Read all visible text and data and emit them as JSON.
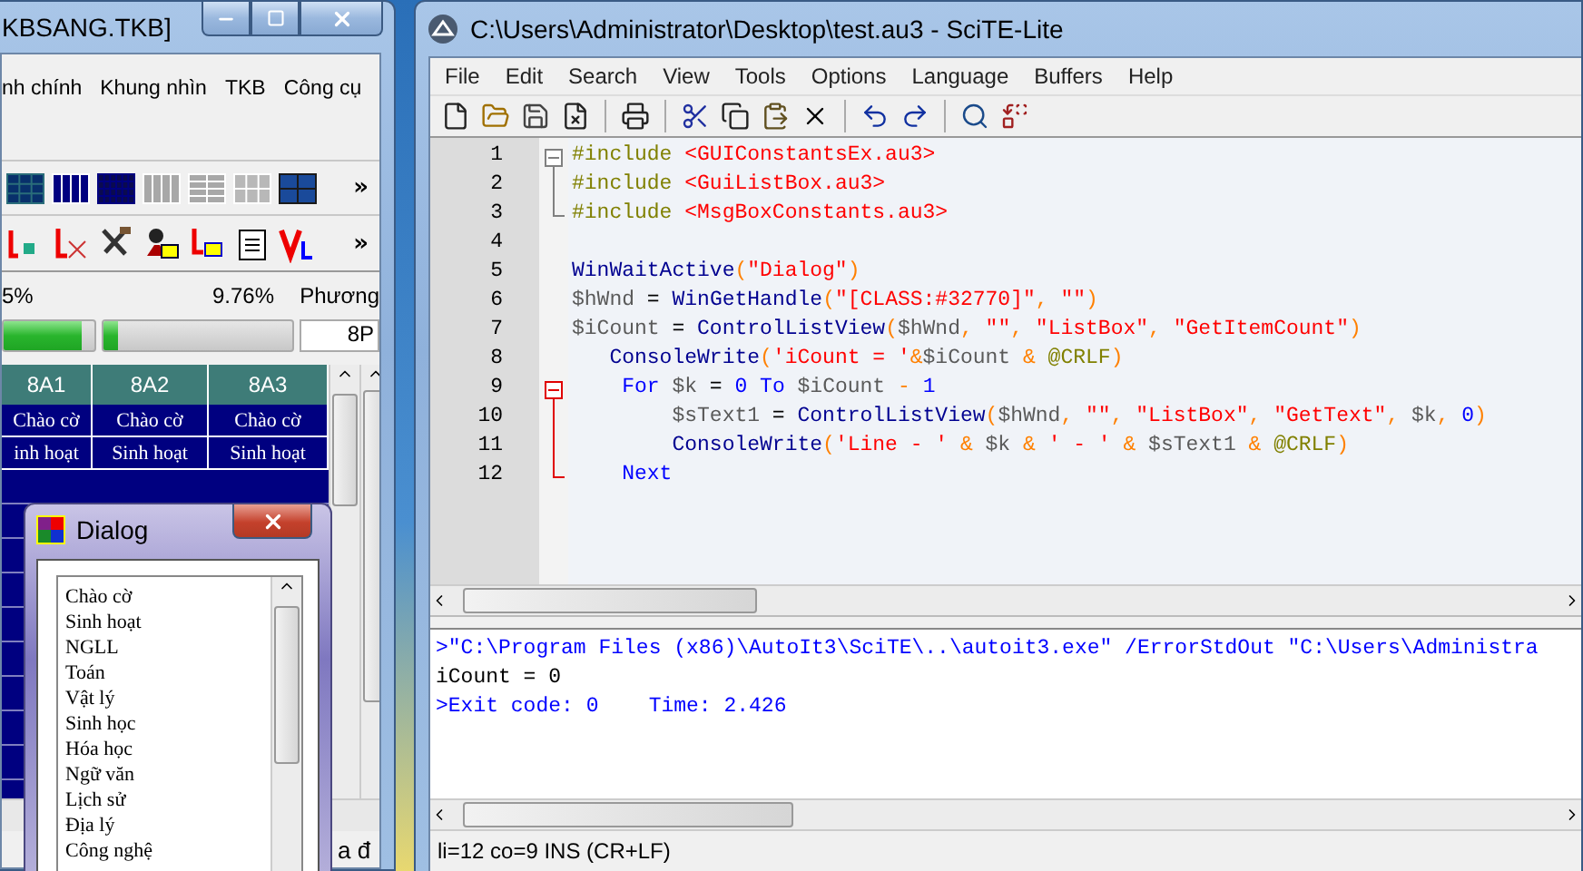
{
  "left_window": {
    "title": "KBSANG.TKB]",
    "menu": [
      "nh chính",
      "Khung nhìn",
      "TKB",
      "Công cụ"
    ],
    "toolbar_overflow": [
      "»",
      "»"
    ],
    "progress": {
      "labels": [
        "5%",
        "9.76%",
        "Phương"
      ],
      "bars": [
        {
          "level": 0.85
        },
        {
          "level": 0.08
        }
      ],
      "field": "8P"
    },
    "grid": {
      "columns": [
        "8A1",
        "8A2",
        "8A3"
      ],
      "rows": [
        [
          "Chào cờ",
          "Chào cờ",
          "Chào cờ"
        ],
        [
          "inh hoạt",
          "Sinh hoạt",
          "Sinh hoạt"
        ]
      ]
    },
    "status_text": "a đ"
  },
  "dialog": {
    "title": "Dialog",
    "items": [
      "Chào cờ",
      "Sinh hoạt",
      "NGLL",
      "Toán",
      "Vật lý",
      "Sinh học",
      "Hóa học",
      "Ngữ văn",
      "Lịch sử",
      "Địa lý",
      "Công nghệ"
    ]
  },
  "editor_window": {
    "title": "C:\\Users\\Administrator\\Desktop\\test.au3 - SciTE-Lite",
    "menu": [
      "File",
      "Edit",
      "Search",
      "View",
      "Tools",
      "Options",
      "Language",
      "Buffers",
      "Help"
    ],
    "code_lines": [
      {
        "number": "1",
        "kind": "fold_start",
        "fold_active": false,
        "tokens": [
          {
            "kind": "directive",
            "text": "#include "
          },
          {
            "kind": "string",
            "text": "<GUIConstantsEx.au3>"
          }
        ]
      },
      {
        "number": "2",
        "kind": "fold_line",
        "fold_active": false,
        "tokens": [
          {
            "kind": "directive",
            "text": "#include "
          },
          {
            "kind": "string",
            "text": "<GuiListBox.au3>"
          }
        ]
      },
      {
        "number": "3",
        "kind": "fold_end",
        "fold_active": false,
        "tokens": [
          {
            "kind": "directive",
            "text": "#include "
          },
          {
            "kind": "string",
            "text": "<MsgBoxConstants.au3>"
          }
        ]
      },
      {
        "number": "4",
        "kind": "plain"
      },
      {
        "number": "5",
        "kind": "plain",
        "tokens": [
          {
            "kind": "func",
            "text": "WinWaitActive"
          },
          {
            "kind": "op",
            "text": "("
          },
          {
            "kind": "string",
            "text": "\"Dialog\""
          },
          {
            "kind": "op",
            "text": ")"
          }
        ]
      },
      {
        "number": "6",
        "kind": "plain",
        "tokens": [
          {
            "kind": "var",
            "text": "$hWnd"
          },
          {
            "kind": "plain",
            "text": " = "
          },
          {
            "kind": "func",
            "text": "WinGetHandle"
          },
          {
            "kind": "op",
            "text": "("
          },
          {
            "kind": "string",
            "text": "\"[CLASS:#32770]\""
          },
          {
            "kind": "op",
            "text": ", "
          },
          {
            "kind": "string",
            "text": "\"\""
          },
          {
            "kind": "op",
            "text": ")"
          }
        ]
      },
      {
        "number": "7",
        "kind": "plain",
        "tokens": [
          {
            "kind": "var",
            "text": "$iCount"
          },
          {
            "kind": "plain",
            "text": " = "
          },
          {
            "kind": "func",
            "text": "ControlListView"
          },
          {
            "kind": "op",
            "text": "("
          },
          {
            "kind": "var",
            "text": "$hWnd"
          },
          {
            "kind": "op",
            "text": ", "
          },
          {
            "kind": "string",
            "text": "\"\""
          },
          {
            "kind": "op",
            "text": ", "
          },
          {
            "kind": "string",
            "text": "\"ListBox\""
          },
          {
            "kind": "op",
            "text": ", "
          },
          {
            "kind": "string",
            "text": "\"GetItemCount\""
          },
          {
            "kind": "op",
            "text": ")"
          }
        ]
      },
      {
        "number": "8",
        "kind": "plain",
        "tokens": [
          {
            "kind": "func",
            "text": "   ConsoleWrite"
          },
          {
            "kind": "op",
            "text": "("
          },
          {
            "kind": "string",
            "text": "'iCount = '"
          },
          {
            "kind": "op",
            "text": "&"
          },
          {
            "kind": "var",
            "text": "$iCount"
          },
          {
            "kind": "op",
            "text": " & "
          },
          {
            "kind": "macro",
            "text": "@CRLF"
          },
          {
            "kind": "op",
            "text": ")"
          }
        ]
      },
      {
        "number": "9",
        "kind": "fold_start",
        "fold_active": true,
        "tokens": [
          {
            "kind": "keyword",
            "text": "    For"
          },
          {
            "kind": "var",
            "text": " $k"
          },
          {
            "kind": "plain",
            "text": " = "
          },
          {
            "kind": "number",
            "text": "0"
          },
          {
            "kind": "keyword",
            "text": " To"
          },
          {
            "kind": "var",
            "text": " $iCount"
          },
          {
            "kind": "op",
            "text": " - "
          },
          {
            "kind": "number",
            "text": "1"
          }
        ]
      },
      {
        "number": "10",
        "kind": "fold_line",
        "fold_active": true,
        "tokens": [
          {
            "kind": "var",
            "text": "        $sText1"
          },
          {
            "kind": "plain",
            "text": " = "
          },
          {
            "kind": "func",
            "text": "ControlListView"
          },
          {
            "kind": "op",
            "text": "("
          },
          {
            "kind": "var",
            "text": "$hWnd"
          },
          {
            "kind": "op",
            "text": ", "
          },
          {
            "kind": "string",
            "text": "\"\""
          },
          {
            "kind": "op",
            "text": ", "
          },
          {
            "kind": "string",
            "text": "\"ListBox\""
          },
          {
            "kind": "op",
            "text": ", "
          },
          {
            "kind": "string",
            "text": "\"GetText\""
          },
          {
            "kind": "op",
            "text": ", "
          },
          {
            "kind": "var",
            "text": "$k"
          },
          {
            "kind": "op",
            "text": ", "
          },
          {
            "kind": "number",
            "text": "0"
          },
          {
            "kind": "op",
            "text": ")"
          }
        ]
      },
      {
        "number": "11",
        "kind": "fold_line",
        "fold_active": true,
        "tokens": [
          {
            "kind": "func",
            "text": "        ConsoleWrite"
          },
          {
            "kind": "op",
            "text": "("
          },
          {
            "kind": "string",
            "text": "'Line - '"
          },
          {
            "kind": "op",
            "text": " & "
          },
          {
            "kind": "var",
            "text": "$k"
          },
          {
            "kind": "op",
            "text": " & "
          },
          {
            "kind": "string",
            "text": "' - '"
          },
          {
            "kind": "op",
            "text": " & "
          },
          {
            "kind": "var",
            "text": "$sText1"
          },
          {
            "kind": "op",
            "text": " & "
          },
          {
            "kind": "macro",
            "text": "@CRLF"
          },
          {
            "kind": "op",
            "text": ")"
          }
        ]
      },
      {
        "number": "12",
        "kind": "fold_end",
        "fold_active": true,
        "tokens": [
          {
            "kind": "keyword",
            "text": "    Next"
          }
        ]
      }
    ],
    "output_lines": [
      {
        "kind": "command",
        "text": ">\"C:\\Program Files (x86)\\AutoIt3\\SciTE\\..\\autoit3.exe\" /ErrorStdOut \"C:\\Users\\Administra"
      },
      {
        "kind": "plain",
        "text": "iCount = 0"
      },
      {
        "kind": "command",
        "text": ">Exit code: 0    Time: 2.426"
      }
    ],
    "status": "li=12 co=9 INS (CR+LF)"
  }
}
